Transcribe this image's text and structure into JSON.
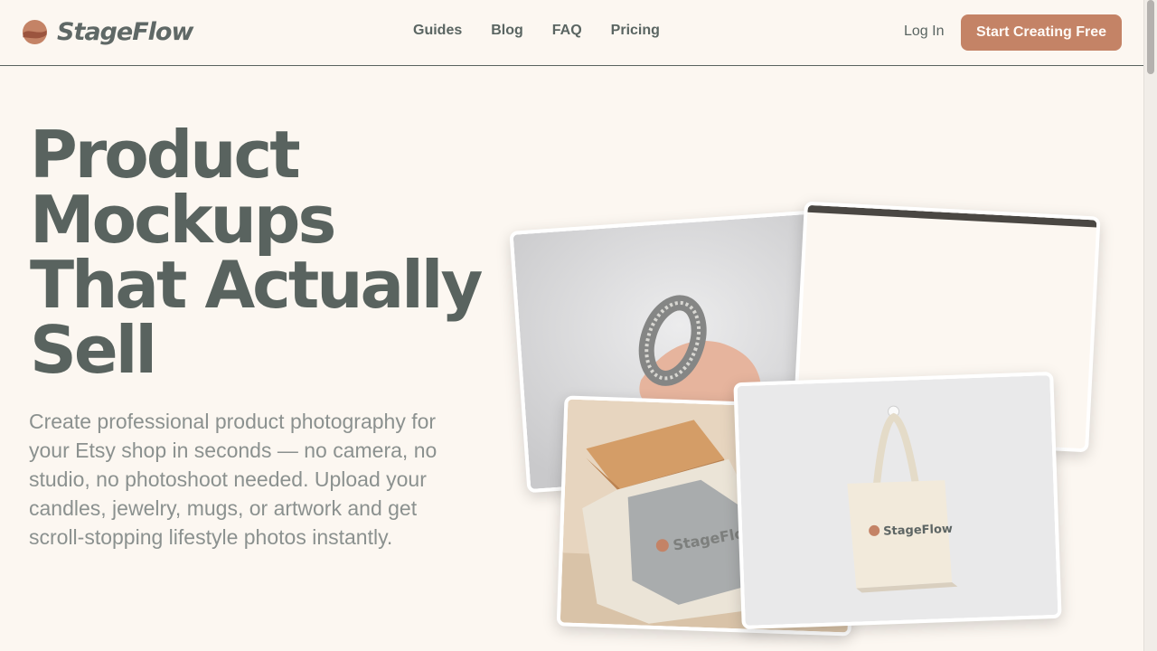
{
  "brand": {
    "name": "StageFlow",
    "accent": "#c48366",
    "text_color": "#59635f",
    "background": "#fcf7f1"
  },
  "nav": {
    "links": [
      "Guides",
      "Blog",
      "FAQ",
      "Pricing"
    ],
    "login_label": "Log In",
    "cta_label": "Start Creating Free"
  },
  "hero": {
    "title_lines": [
      "Product",
      "Mockups",
      "That Actually",
      "Sell"
    ],
    "subtitle": "Create professional product photography for your Etsy shop in seconds — no camera, no studio, no photoshoot needed. Upload your candles, jewelry, mugs, or artwork and get scroll-stopping lifestyle photos instantly."
  },
  "gallery": {
    "shirt_print": "StageFlow",
    "bag_print": "StageFlow"
  }
}
